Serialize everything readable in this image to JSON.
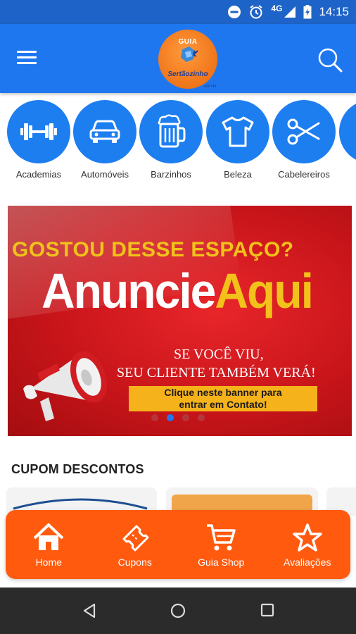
{
  "status_bar": {
    "network": "4G",
    "time": "14:15"
  },
  "app_bar": {
    "logo_top": "GUIA",
    "logo_bottom": "Sertãozinho",
    "logo_domain": ".com.br"
  },
  "categories": [
    {
      "label": "Academias",
      "icon": "dumbbell-icon"
    },
    {
      "label": "Automóveis",
      "icon": "car-icon"
    },
    {
      "label": "Barzinhos",
      "icon": "beer-mug-icon"
    },
    {
      "label": "Beleza",
      "icon": "tshirt-icon"
    },
    {
      "label": "Cabelereiros",
      "icon": "scissors-icon"
    }
  ],
  "banner": {
    "headline": "GOSTOU DESSE ESPAÇO?",
    "cta_white": "Anuncie",
    "cta_yellow": "Aqui",
    "line1": "SE VOCÊ VIU,",
    "line2": "SEU CLIENTE TAMBÉM VERÁ!",
    "box_line1": "Clique neste banner para",
    "box_line2": "entrar em Contato!",
    "active_slide": 2,
    "slide_count": 4
  },
  "coupons": {
    "title": "CUPOM DESCONTOS"
  },
  "bottom_nav": [
    {
      "label": "Home",
      "icon": "home-icon"
    },
    {
      "label": "Cupons",
      "icon": "ticket-icon"
    },
    {
      "label": "Guia Shop",
      "icon": "cart-icon"
    },
    {
      "label": "Avaliações",
      "icon": "star-icon"
    }
  ],
  "colors": {
    "app_bar": "#1f77f0",
    "category_circle": "#1d7ef0",
    "bottom_nav": "#ff5a0e",
    "banner_red": "#c8151a",
    "banner_yellow": "#f2c21b"
  }
}
